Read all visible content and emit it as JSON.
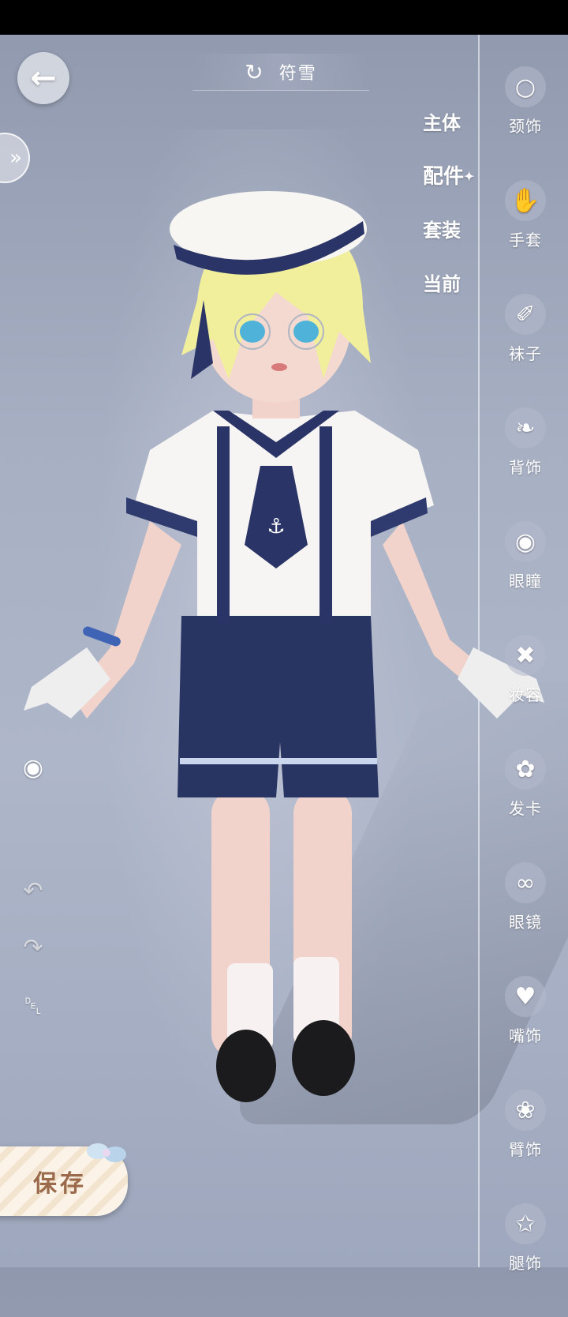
{
  "header": {
    "character_name": "符雪",
    "refresh_icon": "refresh-icon"
  },
  "nav": {
    "back_icon": "arrow-left-icon",
    "expand_icon": "double-chevron-right-icon"
  },
  "tabs": [
    {
      "label": "主体",
      "active": false
    },
    {
      "label": "配件",
      "active": true
    },
    {
      "label": "套装",
      "active": false
    },
    {
      "label": "当前",
      "active": false
    }
  ],
  "categories": [
    {
      "label": "颈饰",
      "icon": "necklace-icon"
    },
    {
      "label": "手套",
      "icon": "glove-icon"
    },
    {
      "label": "袜子",
      "icon": "sock-icon"
    },
    {
      "label": "背饰",
      "icon": "wing-icon"
    },
    {
      "label": "眼瞳",
      "icon": "eye-icon"
    },
    {
      "label": "妆容",
      "icon": "makeup-brush-icon"
    },
    {
      "label": "发卡",
      "icon": "flower-clip-icon"
    },
    {
      "label": "眼镜",
      "icon": "glasses-icon"
    },
    {
      "label": "嘴饰",
      "icon": "pacifier-icon"
    },
    {
      "label": "臂饰",
      "icon": "arm-accessory-icon"
    },
    {
      "label": "腿饰",
      "icon": "leg-accessory-icon"
    }
  ],
  "tools": {
    "toggle_view_icon": "eye-toggle-icon",
    "undo_icon": "undo-icon",
    "redo_icon": "redo-icon",
    "delete_icon": "trash-icon"
  },
  "save": {
    "label": "保存"
  },
  "colors": {
    "accent_navy": "#2a3466",
    "panel_white": "#ffffff",
    "save_text": "#9a6a4a"
  }
}
